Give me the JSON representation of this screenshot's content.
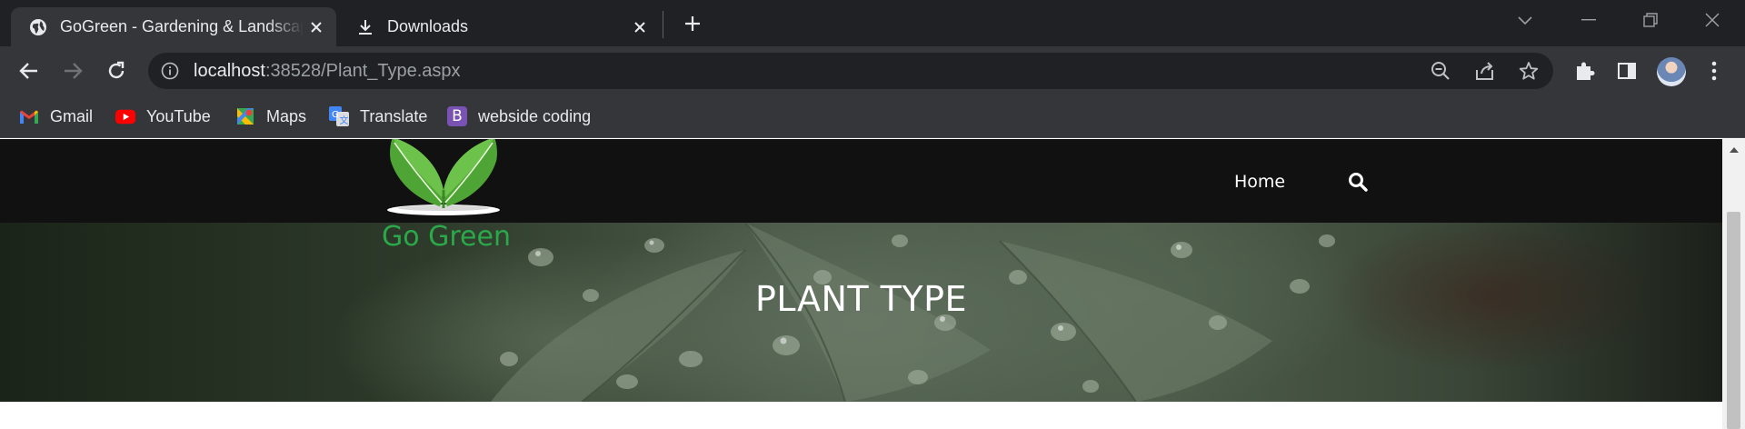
{
  "tabs": [
    {
      "title": "GoGreen - Gardening & Landscaping",
      "favicon": "globe-icon",
      "active": true
    },
    {
      "title": "Downloads",
      "favicon": "download-icon",
      "active": false
    }
  ],
  "address_bar": {
    "host": "localhost",
    "path": ":38528/Plant_Type.aspx"
  },
  "bookmarks": [
    {
      "label": "Gmail",
      "icon": "gmail-icon"
    },
    {
      "label": "YouTube",
      "icon": "youtube-icon"
    },
    {
      "label": "Maps",
      "icon": "maps-icon"
    },
    {
      "label": "Translate",
      "icon": "translate-icon"
    },
    {
      "label": "webside coding",
      "icon": "bootstrap-icon",
      "icon_letter": "B"
    }
  ],
  "site": {
    "logo_text": "Go Green",
    "nav": {
      "home": "Home"
    },
    "hero_title": "PLANT TYPE"
  },
  "colors": {
    "chrome_dark": "#202124",
    "chrome_toolbar": "#35363a",
    "site_header": "#111111",
    "brand_green": "#2aa84a"
  }
}
